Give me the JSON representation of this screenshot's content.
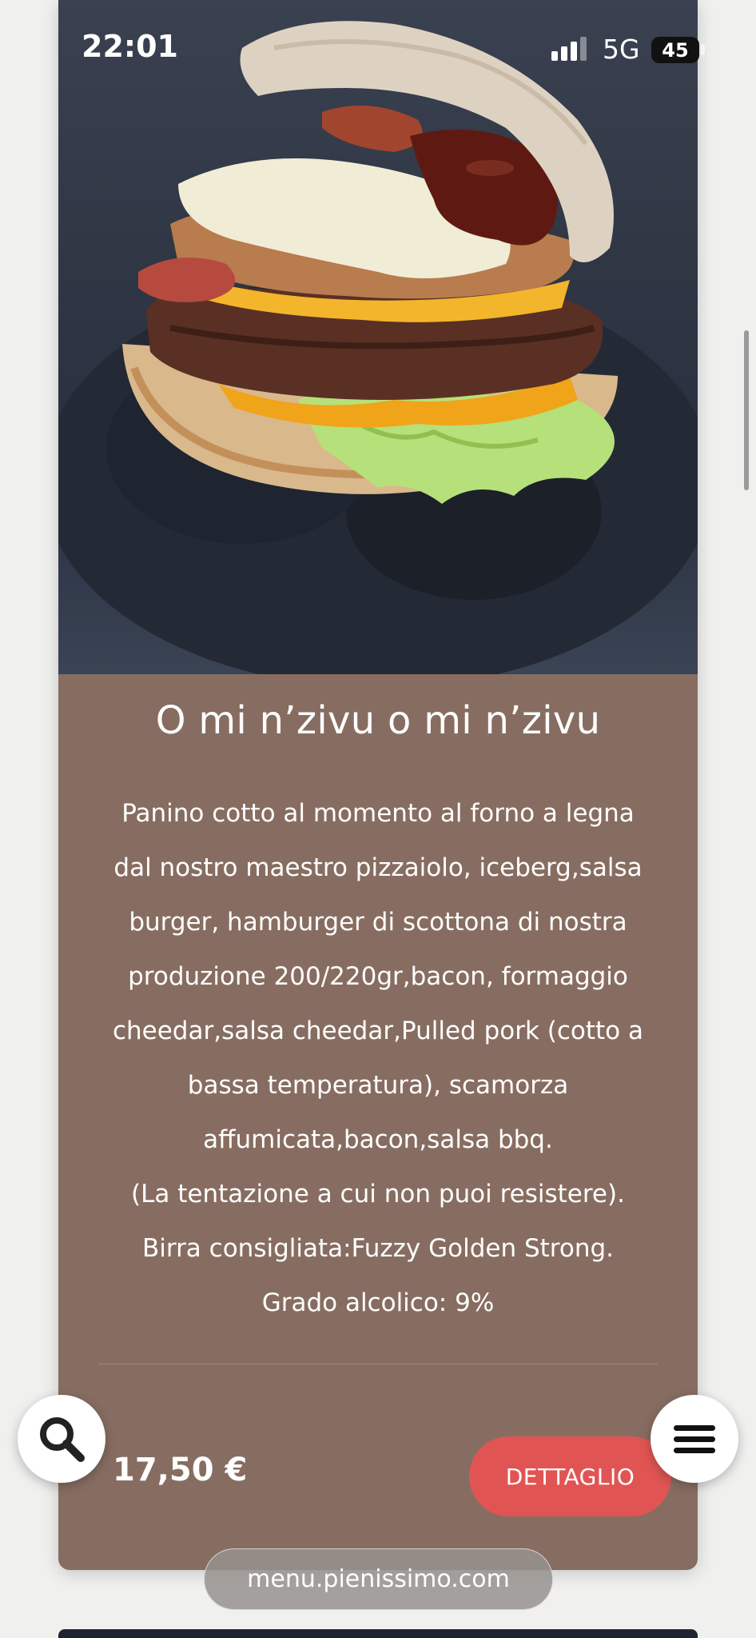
{
  "status_bar": {
    "time": "22:01",
    "network": "5G",
    "battery": "45"
  },
  "product": {
    "title": "O mi n’zivu o mi n’zivu",
    "description_lines": [
      "Panino cotto al momento al forno a legna",
      "dal nostro maestro pizzaiolo, iceberg,salsa",
      "burger, hamburger di scottona di nostra",
      "produzione 200/220gr,bacon, formaggio",
      "cheedar,salsa cheedar,Pulled pork (cotto a",
      "bassa temperatura), scamorza",
      "affumicata,bacon,salsa bbq.",
      "(La tentazione a cui non puoi resistere).",
      "Birra consigliata:Fuzzy Golden Strong.",
      "Grado alcolico: 9%"
    ],
    "price": "17,50 €",
    "detail_button": "DETTAGLIO"
  },
  "browser": {
    "url": "menu.pienissimo.com"
  },
  "icons": {
    "search": "search-icon",
    "menu": "hamburger-menu-icon"
  },
  "colors": {
    "card_bg": "#876d61",
    "button_bg": "#e05553",
    "page_bg": "#f0f0ef"
  }
}
